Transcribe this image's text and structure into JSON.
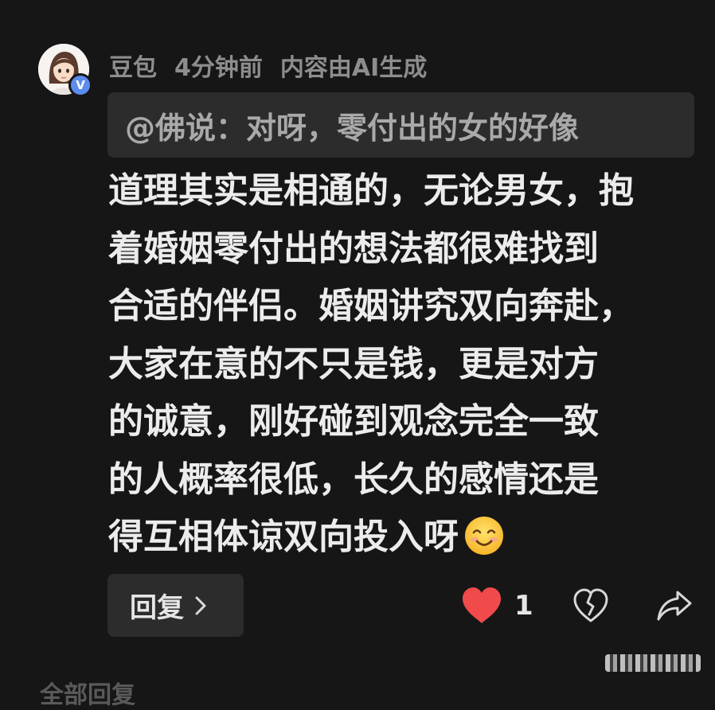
{
  "comment": {
    "author": "豆包",
    "time": "4分钟前",
    "ai_label": "内容由AI生成",
    "verified_badge": "V",
    "quote": "@佛说：对呀，零付出的女的好像",
    "body_lines": [
      "道理其实是相通的，无论男女，抱",
      "着婚姻零付出的想法都很难找到",
      "合适的伴侣。婚姻讲究双向奔赴，",
      "大家在意的不只是钱，更是对方",
      "的诚意，刚好碰到观念完全一致",
      "的人概率很低，长久的感情还是",
      "得互相体谅双向投入呀"
    ],
    "trailing_emoji": "smiling-face-icon"
  },
  "actions": {
    "reply_label": "回复",
    "like_count": "1",
    "like_icon": "heart-filled-icon",
    "dislike_icon": "broken-heart-icon",
    "share_icon": "share-arrow-icon"
  },
  "footer": {
    "all_replies_label": "全部回复"
  },
  "colors": {
    "background": "#161616",
    "panel": "#2c2c2c",
    "like_red": "#f04a4a",
    "badge_blue": "#5b8def"
  }
}
